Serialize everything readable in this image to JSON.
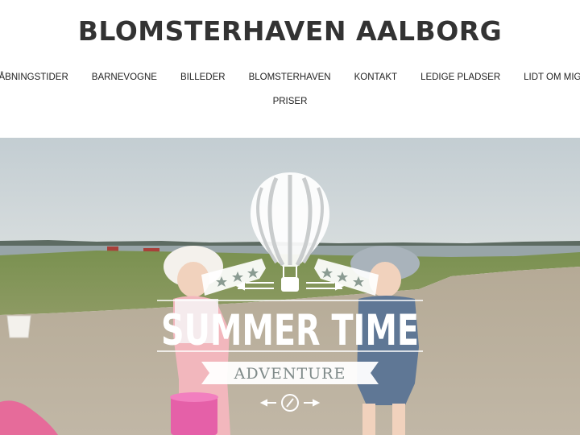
{
  "site": {
    "title": "BLOMSTERHAVEN AALBORG"
  },
  "nav": {
    "row1": [
      "ÅBNINGSTIDER",
      "BARNEVOGNE",
      "BILLEDER",
      "BLOMSTERHAVEN",
      "KONTAKT",
      "LEDIGE PLADSER",
      "LIDT OM MIG"
    ],
    "row2": [
      "PRISER"
    ]
  },
  "hero": {
    "overlay_title": "SUMMER TIME",
    "overlay_subtitle": "ADVENTURE",
    "icons": [
      "hot-air-balloon-icon",
      "star-icon",
      "compass-icon",
      "arrow-icon"
    ],
    "bucket_label": "Pink bucket"
  },
  "colors": {
    "title_text": "#333333",
    "sky": "#c9d2d6",
    "water": "#9aa7ab",
    "grass": "#6f8a45",
    "gravel": "#b7ab99",
    "overlay": "#ffffff"
  }
}
